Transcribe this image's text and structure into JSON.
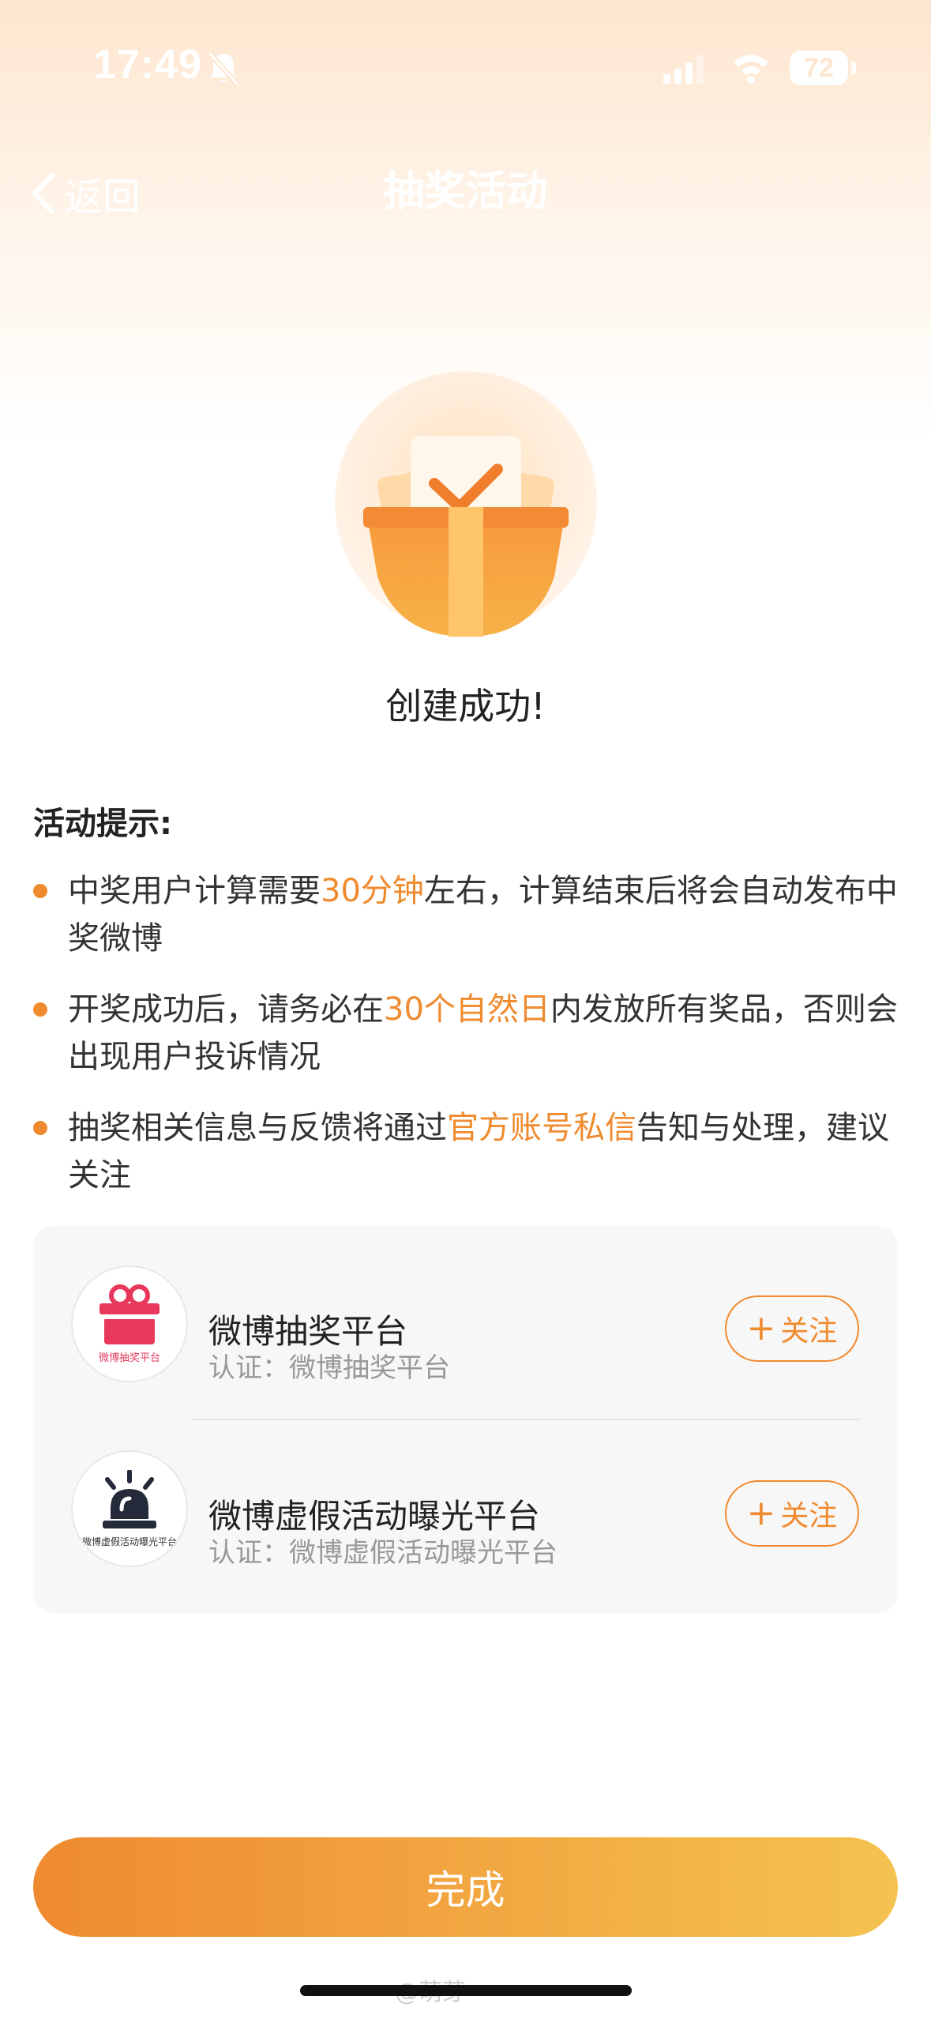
{
  "status_bar": {
    "time": "17:49",
    "battery": "72"
  },
  "nav": {
    "back_label": "返回",
    "title": "抽奖活动"
  },
  "success_title": "创建成功!",
  "tips": {
    "heading": "活动提示:",
    "items": [
      {
        "before": "中奖用户计算需要",
        "highlight": "30分钟",
        "after": "左右，计算结束后将会自动发布中奖微博"
      },
      {
        "before": "开奖成功后，请务必在",
        "highlight": "30个自然日",
        "after": "内发放所有奖品，否则会出现用户投诉情况"
      },
      {
        "before": "抽奖相关信息与反馈将通过",
        "highlight": "官方账号私信",
        "after": "告知与处理，建议关注"
      }
    ]
  },
  "accounts": [
    {
      "name": "微博抽奖平台",
      "verify": "认证：微博抽奖平台",
      "avatar_caption": "微博抽奖平台",
      "follow_label": "关注"
    },
    {
      "name": "微博虚假活动曝光平台",
      "verify": "认证：微博虚假活动曝光平台",
      "avatar_caption": "微博虚假活动曝光平台",
      "follow_label": "关注"
    }
  ],
  "done_label": "完成",
  "watermark": "@萌芽",
  "colors": {
    "accent": "#f08a2e",
    "gradient_start": "#ef8a30",
    "gradient_end": "#f4c251"
  },
  "icons": {
    "bell": "bell-slash-icon",
    "back": "chevron-left-icon",
    "follow": "plus-icon"
  }
}
